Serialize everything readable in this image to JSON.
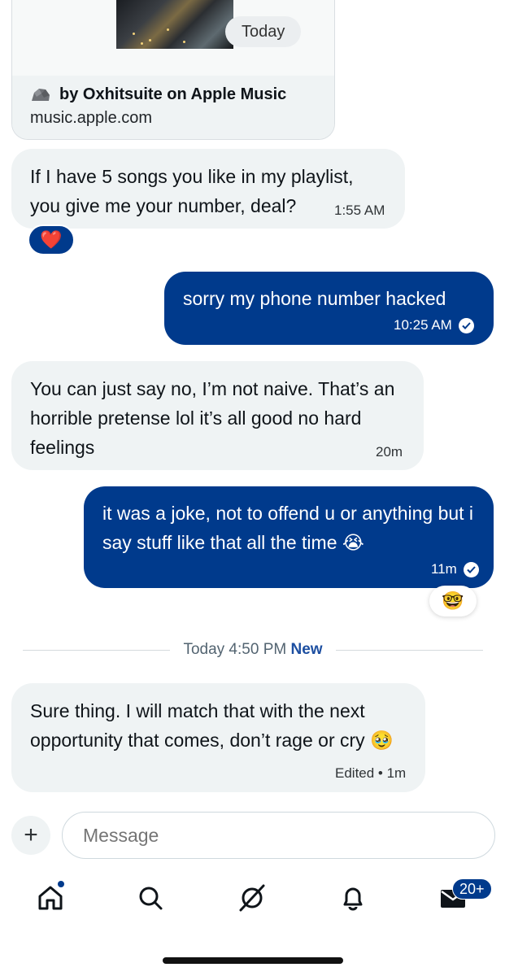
{
  "link_preview": {
    "date_pill": "Today",
    "source": "by Oxhitsuite on Apple Music",
    "domain": "music.apple.com"
  },
  "messages": [
    {
      "direction": "incoming",
      "text": "If I have 5 songs you like in my playlist, you give me your number, deal?",
      "time": "1:55 AM",
      "reaction": "❤️"
    },
    {
      "direction": "outgoing",
      "text": "sorry my phone number hacked",
      "time": "10:25 AM",
      "status": "sent"
    },
    {
      "direction": "incoming",
      "text": "You can just say no, I’m not naive. That’s an horrible pretense lol it’s all good no hard feelings",
      "time": "20m"
    },
    {
      "direction": "outgoing",
      "text": "it was a joke, not to offend u or anything but i say stuff like that all the time 😭",
      "time": "11m",
      "status": "sent",
      "reaction": "🤓"
    },
    {
      "direction": "incoming",
      "text": "Sure thing. I will match that with the next opportunity that comes, don’t rage or cry 🥹",
      "time": "Edited • 1m"
    }
  ],
  "divider": {
    "time": "Today 4:50 PM",
    "new_label": "New"
  },
  "composer": {
    "plus": "+",
    "placeholder": "Message"
  },
  "nav": {
    "items": [
      "home-icon",
      "search-icon",
      "grok-icon",
      "notifications-icon",
      "messages-icon"
    ],
    "messages_badge": "20+"
  },
  "colors": {
    "accent": "#003a8c",
    "incoming_bubble": "#eff3f4"
  }
}
